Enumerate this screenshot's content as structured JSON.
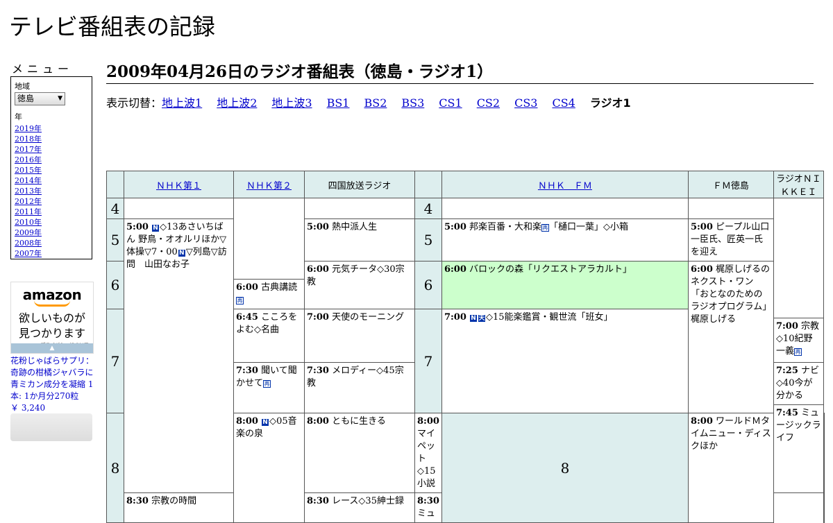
{
  "site_title": "テレビ番組表の記録",
  "menu": {
    "heading": "メニュー",
    "region_label": "地域",
    "region_selected": "徳島",
    "year_label": "年",
    "years": [
      "2019年",
      "2018年",
      "2017年",
      "2016年",
      "2015年",
      "2014年",
      "2013年",
      "2012年",
      "2011年",
      "2010年",
      "2009年",
      "2008年",
      "2007年"
    ]
  },
  "ad": {
    "brand": "amazon",
    "line1": "欲しいものが",
    "line2": "見つかります",
    "privacy": "プライバシーについて",
    "arrow": "▲"
  },
  "promo": {
    "text": "花粉じゃばらサプリ：奇跡の柑橘ジャバラに青ミカン成分を凝縮 1本: 1か月分270粒",
    "price": "￥ 3,240"
  },
  "page_title": "2009年04月26日のラジオ番組表（徳島・ラジオ1）",
  "switch": {
    "label": "表示切替：",
    "links": [
      "地上波1",
      "地上波2",
      "地上波3",
      "BS1",
      "BS2",
      "BS3",
      "CS1",
      "CS2",
      "CS3",
      "CS4"
    ],
    "current": "ラジオ1"
  },
  "channels": {
    "nhk1": "ＮＨＫ第１",
    "nhk2": "ＮＨＫ第２",
    "shikoku": "四国放送ラジオ",
    "nhkfm": "ＮＨＫ　ＦＭ",
    "fmtokushima": "ＦＭ徳島",
    "nikkei": "ラジオＮＩＫＫＥＩ"
  },
  "hours": [
    "4",
    "5",
    "6",
    "7",
    "8"
  ],
  "programs": {
    "nhk1_500": {
      "time": "5:00",
      "pre": "",
      "post": "◇13あさいちばん 野鳥・オオルリほか▽体操▽7・00",
      "post2": "▽列島▽訪問　山田なお子"
    },
    "nhk1_800": {
      "time": "8:00",
      "post": "◇05音楽の泉"
    },
    "nhk2_600": {
      "time": "6:00",
      "text": "古典講読"
    },
    "nhk2_645": {
      "time": "6:45",
      "text": "こころをよむ◇名曲"
    },
    "nhk2_730": {
      "time": "7:30",
      "text": "聞いて聞かせて"
    },
    "nhk2_800": {
      "time": "8:00",
      "text": "ともに生きる"
    },
    "nhk2_830": {
      "time": "8:30",
      "text": "宗教の時間"
    },
    "shikoku_500": {
      "time": "5:00",
      "text": "熱中派人生"
    },
    "shikoku_600": {
      "time": "6:00",
      "text": "元気チータ◇30宗教"
    },
    "shikoku_700": {
      "time": "7:00",
      "text": "天使のモーニング"
    },
    "shikoku_730": {
      "time": "7:30",
      "text": "メロディー◇45宗教"
    },
    "shikoku_800": {
      "time": "8:00",
      "text": "マイペット◇15小説"
    },
    "shikoku_830": {
      "time": "8:30",
      "text": "レース◇35紳士録"
    },
    "fm_500": {
      "time": "5:00",
      "pre": "邦楽百番・大和楽",
      "post": "「樋口一葉」◇小箱"
    },
    "fm_600": {
      "time": "6:00",
      "text": "バロックの森「リクエストアラカルト」"
    },
    "fm_700": {
      "time": "7:00",
      "post": "◇15能楽鑑賞・観世流「班女」"
    },
    "fm_800": {
      "time": "8:00",
      "text": "ワールドＭタイムニュー・ディスクほか"
    },
    "fmt_500": {
      "time": "5:00",
      "text": "ピープル山口一臣氏、匠英一氏を迎え"
    },
    "fmt_600": {
      "time": "6:00",
      "text": "梶原しげるのネクスト・ワン「おとなのためのラジオプログラム」梶原しげる"
    },
    "nk_700": {
      "time": "7:00",
      "pre": "宗教◇10紀野一義"
    },
    "nk_725": {
      "time": "7:25",
      "text": "ナビ◇40今が分かる"
    },
    "nk_745": {
      "time": "7:45",
      "text": "ミュージックライフ"
    },
    "nk_830": {
      "time": "8:30",
      "text": "ミュ"
    }
  },
  "badges": {
    "news": "N",
    "re": "再",
    "ten": "天"
  }
}
